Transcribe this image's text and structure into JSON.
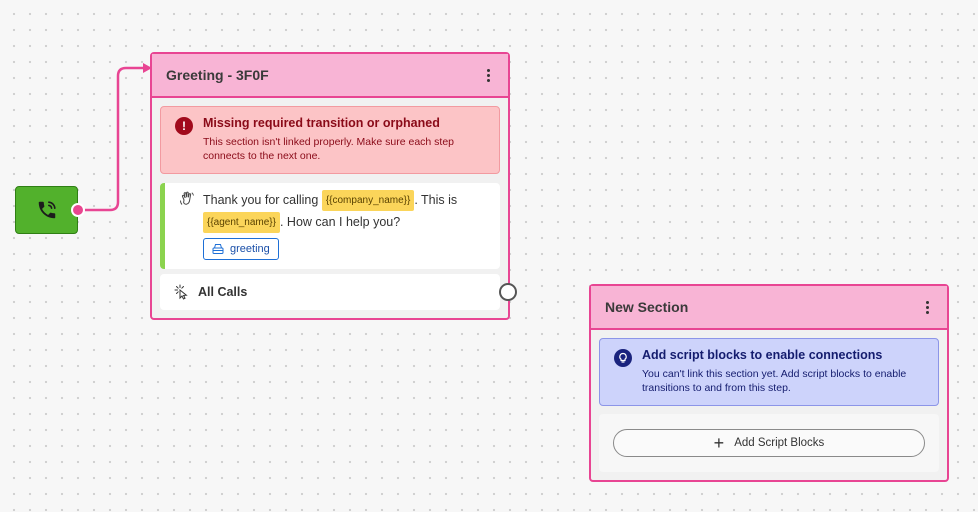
{
  "canvas": {
    "accent_color": "#e84593",
    "start_node_color": "#52b12c"
  },
  "start_node": {
    "icon": "phone-call-icon"
  },
  "sections": [
    {
      "title": "Greeting - 3F0F",
      "menu_icon": "kebab-menu-icon",
      "alert": {
        "type": "error",
        "icon": "exclamation-icon",
        "title": "Missing required transition or orphaned",
        "line1": "This section isn't linked properly. Make sure each step",
        "line2": "connects to the next one."
      },
      "script_block": {
        "icon": "hand-wave-icon",
        "text_before": "Thank you for calling ",
        "var1": "{{company_name}}",
        "text_middle": ". This is",
        "var2": "{{agent_name}}",
        "text_after": ". How can I help you?",
        "tag": "greeting",
        "tag_icon": "tag-icon"
      },
      "transition": {
        "icon": "pointer-click-icon",
        "label": "All Calls"
      }
    },
    {
      "title": "New Section",
      "menu_icon": "kebab-menu-icon",
      "alert": {
        "type": "info",
        "icon": "lightbulb-icon",
        "title": "Add script blocks to enable connections",
        "line1": "You can't link this section yet. Add script blocks to enable",
        "line2": "transitions to and from this step."
      },
      "add_button": {
        "label": "Add Script Blocks",
        "icon": "plus-icon"
      }
    }
  ]
}
